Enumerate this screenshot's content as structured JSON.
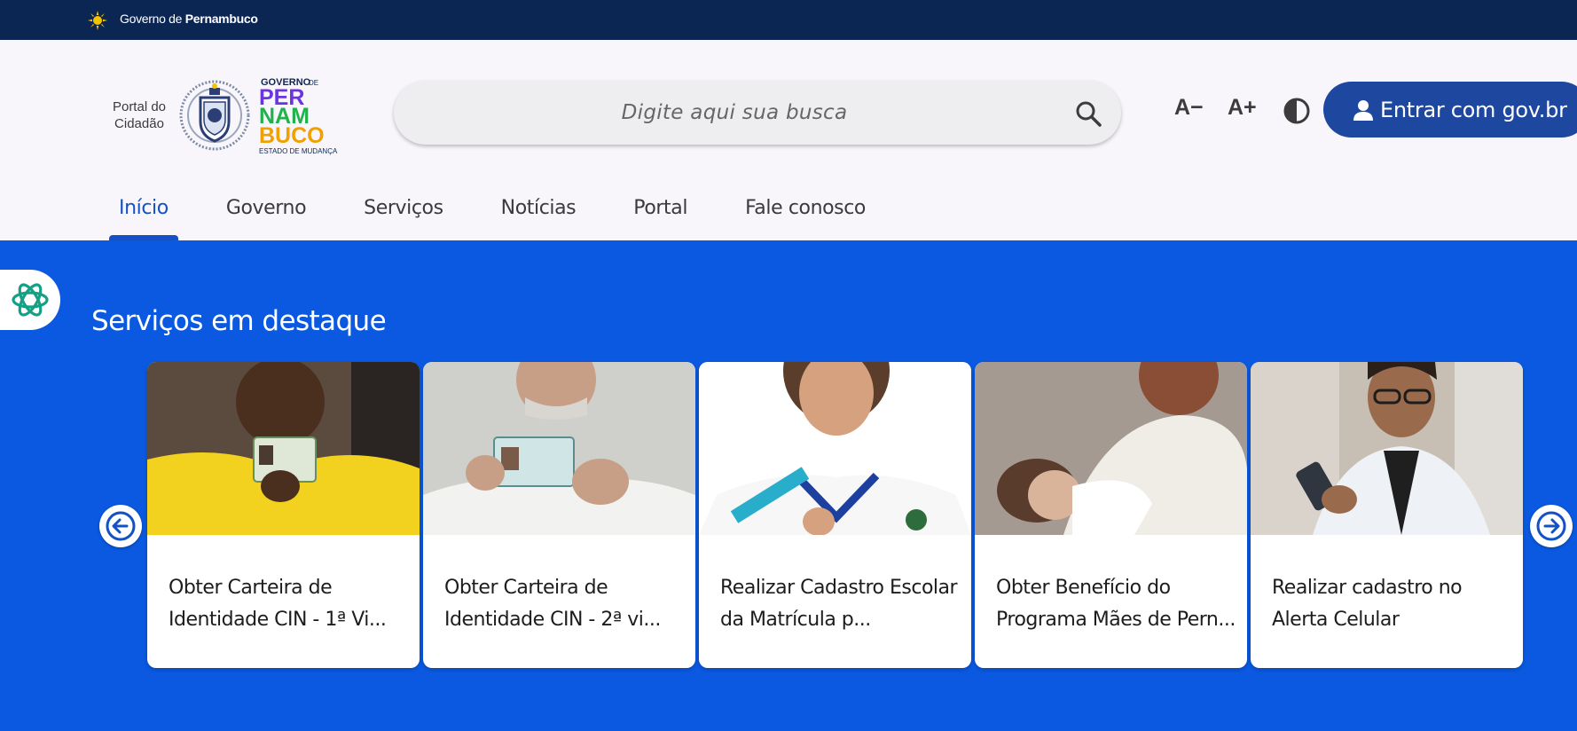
{
  "gov_bar": {
    "prefix": "Governo de",
    "state": "Pernambuco"
  },
  "header": {
    "portal_label_line1": "Portal do",
    "portal_label_line2": "Cidadão",
    "logo_text": {
      "top": "GOVERNO",
      "top_small": "DE",
      "line1": "PER",
      "line2": "NAM",
      "line3": "BUCO",
      "tagline": "ESTADO DE MUDANÇA"
    },
    "search_placeholder": "Digite aqui sua busca",
    "font_decrease": "A−",
    "font_increase": "A+",
    "login_label": "Entrar com gov.br"
  },
  "nav": {
    "items": [
      {
        "label": "Início",
        "active": true
      },
      {
        "label": "Governo",
        "active": false
      },
      {
        "label": "Serviços",
        "active": false
      },
      {
        "label": "Notícias",
        "active": false
      },
      {
        "label": "Portal",
        "active": false
      },
      {
        "label": "Fale conosco",
        "active": false
      }
    ]
  },
  "featured": {
    "title": "Serviços em destaque",
    "cards": [
      {
        "title": "Obter Carteira de Identidade CIN - 1ª Vi...",
        "image": "woman-holding-id-card"
      },
      {
        "title": "Obter Carteira de Identidade CIN - 2ª vi...",
        "image": "older-man-holding-id-card"
      },
      {
        "title": "Realizar Cadastro Escolar da Matrícula p...",
        "image": "student-with-backpack"
      },
      {
        "title": "Obter Benefício do Programa Mães de Pern...",
        "image": "mother-holding-baby"
      },
      {
        "title": "Realizar cadastro no Alerta Celular",
        "image": "man-using-phone"
      }
    ]
  },
  "colors": {
    "gov_bar": "#0c2654",
    "header_bg": "#f9f6fb",
    "main_bg": "#0a59e0",
    "login_button": "#1e47a0",
    "nav_active": "#1351c4"
  }
}
